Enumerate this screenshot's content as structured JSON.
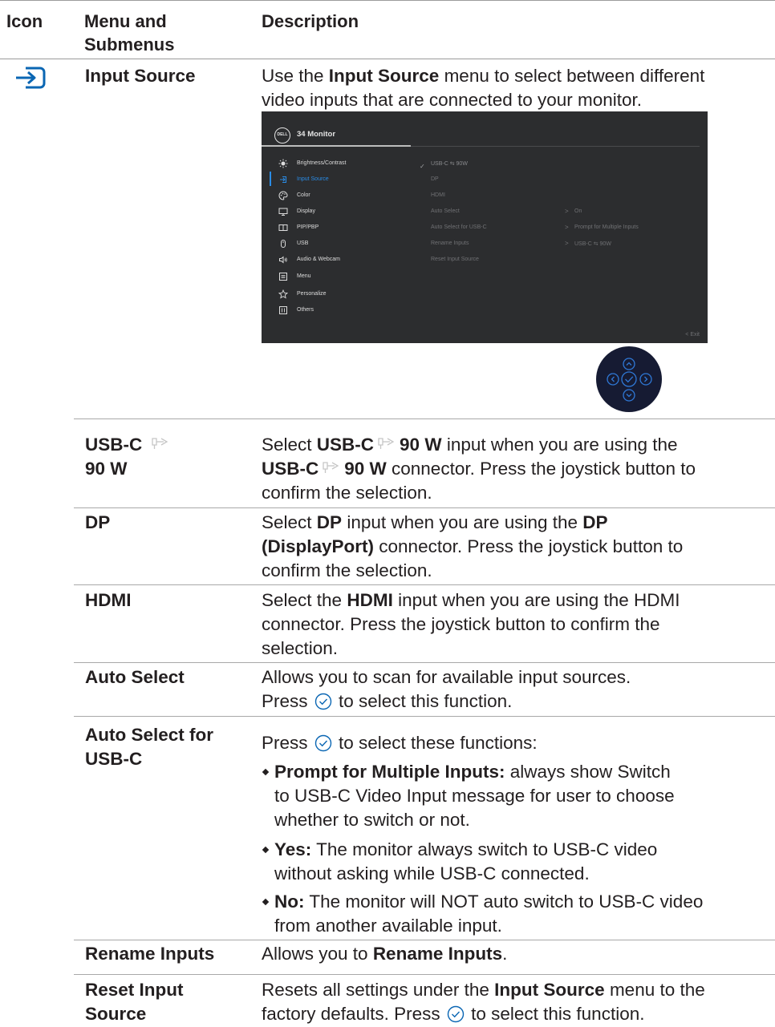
{
  "header": {
    "icon": "Icon",
    "menu_line1": "Menu and",
    "menu_line2": "Submenus",
    "description": "Description"
  },
  "input_source": {
    "icon": "input-source-icon",
    "name": "Input Source",
    "desc_pre": "Use the ",
    "desc_bold": "Input Source",
    "desc_post1": " menu to select between different",
    "desc_line2": "video inputs that are connected to your monitor."
  },
  "osd": {
    "logo": "DELL",
    "title": "34 Monitor",
    "menu_items": [
      {
        "label": "Brightness/Contrast",
        "icon": "brightness-icon"
      },
      {
        "label": "Input Source",
        "icon": "input-icon"
      },
      {
        "label": "Color",
        "icon": "palette-icon"
      },
      {
        "label": "Display",
        "icon": "display-icon"
      },
      {
        "label": "PIP/PBP",
        "icon": "pip-icon"
      },
      {
        "label": "USB",
        "icon": "usb-mouse-icon"
      },
      {
        "label": "Audio & Webcam",
        "icon": "speaker-icon"
      },
      {
        "label": "Menu",
        "icon": "menu-icon"
      },
      {
        "label": "Personalize",
        "icon": "star-icon"
      },
      {
        "label": "Others",
        "icon": "others-icon"
      }
    ],
    "active_index": 1,
    "check": "✓",
    "sub_items": [
      "USB-C ⇆ 90W",
      "DP",
      "HDMI",
      "Auto Select",
      "Auto Select for USB-C",
      "Rename Inputs",
      "Reset Input Source"
    ],
    "values": [
      {
        "arrow": ">",
        "text": "On"
      },
      {
        "arrow": ">",
        "text": "Prompt for Multiple Inputs"
      },
      {
        "arrow": ">",
        "text": "USB-C ⇆ 90W"
      }
    ],
    "exit": "<  Exit",
    "progress": 0.34
  },
  "joystick": {
    "icon": "joystick-icon"
  },
  "rows": {
    "usbc": {
      "name1": "USB-C",
      "name2": "90 W",
      "l1_a": "Select ",
      "l1_b": "USB-C",
      "l1_c": "90 W",
      "l1_d": " input when you are using the",
      "l2_a": "USB-C",
      "l2_b": "90 W",
      "l2_c": " connector. Press the joystick button to",
      "l3": "confirm the selection."
    },
    "dp": {
      "name": "DP",
      "l1_a": "Select ",
      "l1_b": "DP",
      "l1_c": " input when you are using the ",
      "l1_d": "DP",
      "l2_a": "(DisplayPort)",
      "l2_b": " connector. Press the joystick button to",
      "l3": "confirm the selection."
    },
    "hdmi": {
      "name": "HDMI",
      "l1_a": "Select the ",
      "l1_b": "HDMI",
      "l1_c": " input when you are using the HDMI",
      "l2": "connector. Press the joystick button to confirm the",
      "l3": "selection."
    },
    "auto": {
      "name": "Auto Select",
      "l1": "Allows you to scan for available input sources.",
      "l2_a": "Press ",
      "l2_b": " to select this function."
    },
    "auto_usbc": {
      "name1": "Auto Select for",
      "name2": "USB-C",
      "intro_a": "Press ",
      "intro_b": " to select these functions:",
      "b1_bold": "Prompt for Multiple Inputs:",
      "b1_l1": " always show Switch",
      "b1_l2": "to USB-C Video Input message for user to choose",
      "b1_l3": "whether to switch or not.",
      "b2_bold": "Yes:",
      "b2_l1": " The monitor always switch to USB-C video",
      "b2_l2": "without asking while USB-C connected.",
      "b3_bold": "No:",
      "b3_l1": " The monitor will NOT auto switch to USB-C video",
      "b3_l2": "from another available input."
    },
    "rename": {
      "name": "Rename Inputs",
      "l1_a": "Allows you to ",
      "l1_b": "Rename Inputs",
      "l1_c": "."
    },
    "reset": {
      "name1": "Reset Input",
      "name2": "Source",
      "l1_a": "Resets all settings under the ",
      "l1_b": "Input Source",
      "l1_c": " menu to the",
      "l2_a": "factory defaults. Press ",
      "l2_b": " to select this function."
    }
  },
  "colors": {
    "text": "#231f20",
    "accent": "#2a8ce6",
    "osd_bg": "#2c2d2f",
    "joystick_bg": "#161b33"
  }
}
